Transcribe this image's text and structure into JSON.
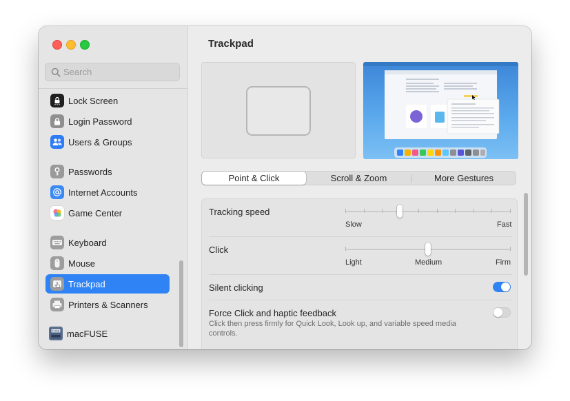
{
  "window": {
    "title": "Trackpad"
  },
  "search": {
    "placeholder": "Search"
  },
  "sidebar": {
    "items": [
      {
        "label": "Lock Screen",
        "icon": "lock-screen-icon",
        "selected": false
      },
      {
        "label": "Login Password",
        "icon": "lock-icon",
        "selected": false
      },
      {
        "label": "Users & Groups",
        "icon": "users-groups-icon",
        "selected": false
      },
      {
        "label": "Passwords",
        "icon": "key-icon",
        "selected": false
      },
      {
        "label": "Internet Accounts",
        "icon": "at-sign-icon",
        "selected": false
      },
      {
        "label": "Game Center",
        "icon": "game-center-icon",
        "selected": false
      },
      {
        "label": "Keyboard",
        "icon": "keyboard-icon",
        "selected": false
      },
      {
        "label": "Mouse",
        "icon": "mouse-icon",
        "selected": false
      },
      {
        "label": "Trackpad",
        "icon": "trackpad-icon",
        "selected": true
      },
      {
        "label": "Printers & Scanners",
        "icon": "printer-icon",
        "selected": false
      },
      {
        "label": "macFUSE",
        "icon": "macfuse-icon",
        "selected": false
      }
    ]
  },
  "tabs": [
    {
      "label": "Point & Click",
      "active": true
    },
    {
      "label": "Scroll & Zoom",
      "active": false
    },
    {
      "label": "More Gestures",
      "active": false
    }
  ],
  "settings": {
    "tracking_speed": {
      "label": "Tracking speed",
      "min_label": "Slow",
      "max_label": "Fast",
      "value_fraction": 0.33
    },
    "click": {
      "label": "Click",
      "options": [
        "Light",
        "Medium",
        "Firm"
      ],
      "value": "Medium"
    },
    "silent_clicking": {
      "label": "Silent clicking",
      "on": true
    },
    "force_click": {
      "label": "Force Click and haptic feedback",
      "description": "Click then press firmly for Quick Look, Look up, and variable speed media controls.",
      "on": false
    }
  },
  "colors": {
    "accent": "#2f83f5",
    "sidebar_bg": "#e5e5e5",
    "content_bg": "#ececec"
  }
}
